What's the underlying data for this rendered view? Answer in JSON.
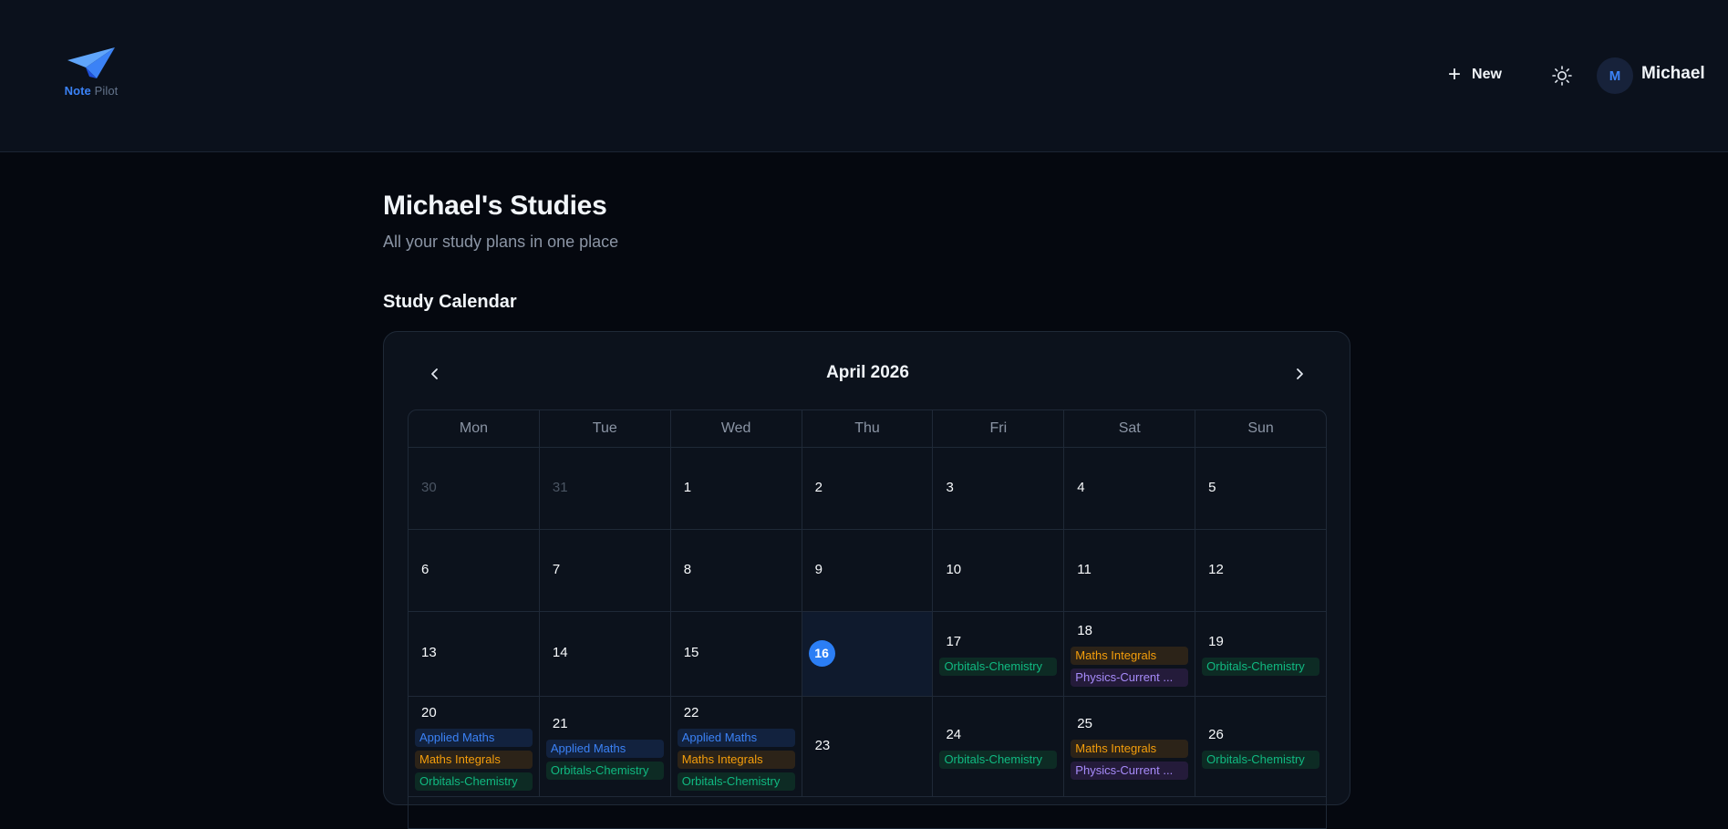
{
  "header": {
    "logo_primary": "Note",
    "logo_secondary": "Pilot",
    "new_label": "New",
    "avatar_initial": "M",
    "user_name": "Michael"
  },
  "page": {
    "title": "Michael's Studies",
    "subtitle": "All your study plans in one place",
    "section_title": "Study Calendar"
  },
  "calendar": {
    "month_label": "April 2026",
    "weekdays": [
      "Mon",
      "Tue",
      "Wed",
      "Thu",
      "Fri",
      "Sat",
      "Sun"
    ],
    "weeks": [
      [
        {
          "day": "30",
          "muted": true,
          "events": []
        },
        {
          "day": "31",
          "muted": true,
          "events": []
        },
        {
          "day": "1",
          "events": []
        },
        {
          "day": "2",
          "events": []
        },
        {
          "day": "3",
          "events": []
        },
        {
          "day": "4",
          "events": []
        },
        {
          "day": "5",
          "events": []
        }
      ],
      [
        {
          "day": "6",
          "events": []
        },
        {
          "day": "7",
          "events": []
        },
        {
          "day": "8",
          "events": []
        },
        {
          "day": "9",
          "events": []
        },
        {
          "day": "10",
          "events": []
        },
        {
          "day": "11",
          "events": []
        },
        {
          "day": "12",
          "events": []
        }
      ],
      [
        {
          "day": "13",
          "events": []
        },
        {
          "day": "14",
          "events": []
        },
        {
          "day": "15",
          "events": []
        },
        {
          "day": "16",
          "today": true,
          "events": []
        },
        {
          "day": "17",
          "events": [
            {
              "label": "Orbitals-Chemistry",
              "color": "green"
            }
          ]
        },
        {
          "day": "18",
          "events": [
            {
              "label": "Maths Integrals",
              "color": "amber"
            },
            {
              "label": "Physics-Current ...",
              "color": "purple"
            }
          ]
        },
        {
          "day": "19",
          "events": [
            {
              "label": "Orbitals-Chemistry",
              "color": "green"
            }
          ]
        }
      ],
      [
        {
          "day": "20",
          "events": [
            {
              "label": "Applied Maths",
              "color": "blue"
            },
            {
              "label": "Maths Integrals",
              "color": "amber"
            },
            {
              "label": "Orbitals-Chemistry",
              "color": "green"
            }
          ]
        },
        {
          "day": "21",
          "events": [
            {
              "label": "Applied Maths",
              "color": "blue"
            },
            {
              "label": "Orbitals-Chemistry",
              "color": "green"
            }
          ]
        },
        {
          "day": "22",
          "events": [
            {
              "label": "Applied Maths",
              "color": "blue"
            },
            {
              "label": "Maths Integrals",
              "color": "amber"
            },
            {
              "label": "Orbitals-Chemistry",
              "color": "green"
            }
          ]
        },
        {
          "day": "23",
          "events": []
        },
        {
          "day": "24",
          "events": [
            {
              "label": "Orbitals-Chemistry",
              "color": "green"
            }
          ]
        },
        {
          "day": "25",
          "events": [
            {
              "label": "Maths Integrals",
              "color": "amber"
            },
            {
              "label": "Physics-Current ...",
              "color": "purple"
            }
          ]
        },
        {
          "day": "26",
          "events": [
            {
              "label": "Orbitals-Chemistry",
              "color": "green"
            }
          ]
        }
      ]
    ]
  },
  "colors": {
    "accent": "#2b7ef5",
    "green": "#10b981",
    "amber": "#f59e0b",
    "purple": "#a78bfa",
    "blue": "#3b82f6"
  },
  "icons": {
    "logo": "paper-plane-icon",
    "new": "plus-icon",
    "theme": "sun-icon",
    "prev": "chevron-left-icon",
    "next": "chevron-right-icon"
  }
}
